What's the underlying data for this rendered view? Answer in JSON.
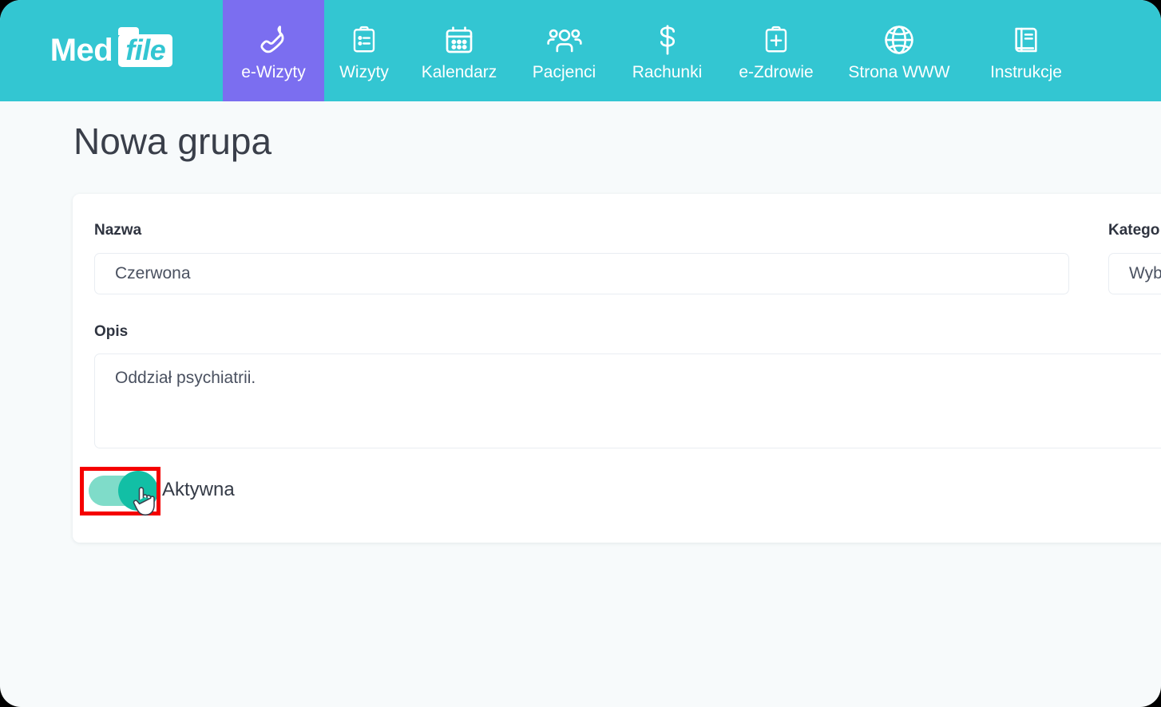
{
  "brand": {
    "name_part1": "Med",
    "name_part2": "file"
  },
  "nav": {
    "items": [
      {
        "label": "e-Wizyty",
        "icon": "phone-icon",
        "active": true
      },
      {
        "label": "Wizyty",
        "icon": "clipboard-list-icon",
        "active": false
      },
      {
        "label": "Kalendarz",
        "icon": "calendar-icon",
        "active": false
      },
      {
        "label": "Pacjenci",
        "icon": "people-group-icon",
        "active": false
      },
      {
        "label": "Rachunki",
        "icon": "dollar-sign-icon",
        "active": false
      },
      {
        "label": "e-Zdrowie",
        "icon": "clipboard-plus-icon",
        "active": false
      },
      {
        "label": "Strona WWW",
        "icon": "globe-icon",
        "active": false
      },
      {
        "label": "Instrukcje",
        "icon": "book-icon",
        "active": false
      }
    ]
  },
  "page": {
    "title": "Nowa grupa"
  },
  "form": {
    "name": {
      "label": "Nazwa",
      "value": "Czerwona",
      "placeholder": ""
    },
    "category": {
      "label": "Katego",
      "value": "Wyb",
      "placeholder": ""
    },
    "description": {
      "label": "Opis",
      "value": "Oddział psychiatrii.",
      "placeholder": ""
    },
    "active_toggle": {
      "label": "Aktywna",
      "state": "on"
    }
  },
  "colors": {
    "header_teal": "#33c6d2",
    "active_tab_purple": "#7b6ef0",
    "toggle_track": "#7fdcc9",
    "toggle_knob": "#12bfa5",
    "highlight_red": "#f50000",
    "page_background": "#f7fafb",
    "card_background": "#ffffff"
  }
}
